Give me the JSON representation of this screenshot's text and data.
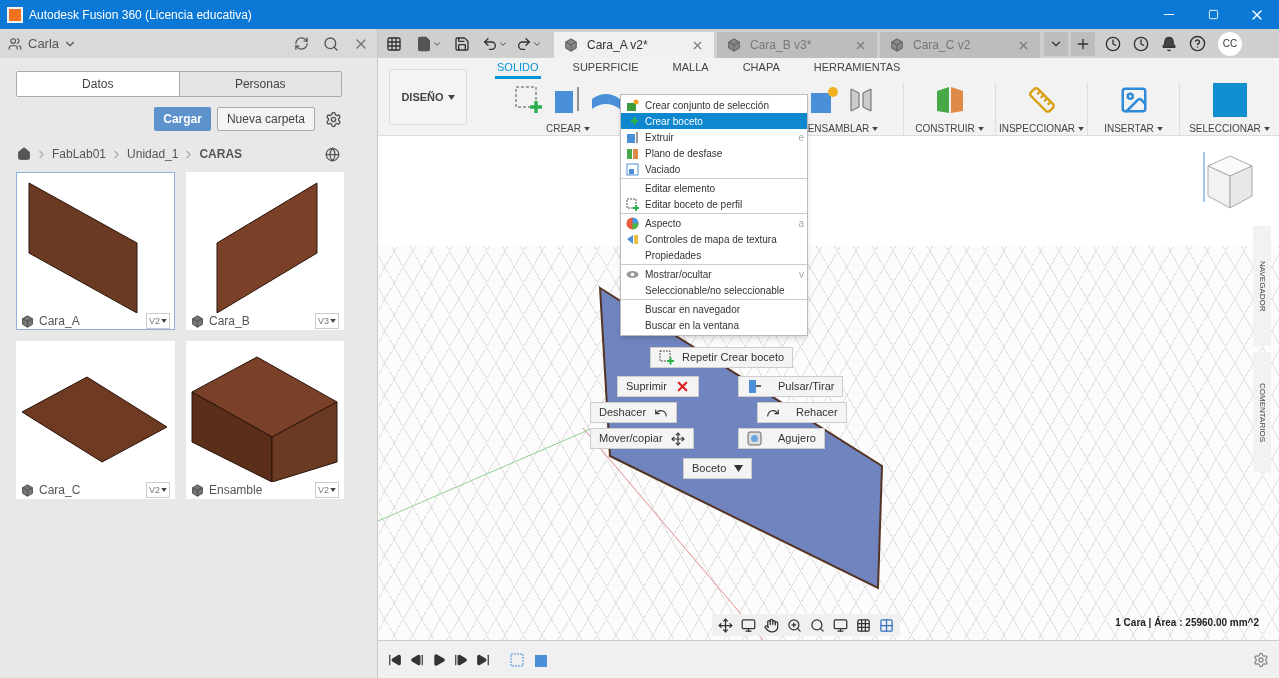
{
  "window": {
    "title": "Autodesk Fusion 360 (Licencia educativa)"
  },
  "data_panel": {
    "project": "Carla",
    "tabs": [
      {
        "label": "Datos",
        "selected": true
      },
      {
        "label": "Personas",
        "selected": false
      }
    ],
    "upload_button": "Cargar",
    "new_folder_button": "Nueva carpeta",
    "breadcrumb": [
      "FabLab01",
      "Unidad_1",
      "CARAS"
    ],
    "files": [
      {
        "name": "Cara_A",
        "version": "V2",
        "selected": true,
        "kind": "panel_a"
      },
      {
        "name": "Cara_B",
        "version": "V3",
        "selected": false,
        "kind": "panel_b"
      },
      {
        "name": "Cara_C",
        "version": "V2",
        "selected": false,
        "kind": "panel_c"
      },
      {
        "name": "Ensamble",
        "version": "V2",
        "selected": false,
        "kind": "box"
      }
    ]
  },
  "document_tabs": [
    {
      "label": "Cara_A v2*",
      "selected": true
    },
    {
      "label": "Cara_B v3*",
      "selected": false
    },
    {
      "label": "Cara_C v2",
      "selected": false
    }
  ],
  "user_initials": "CC",
  "toolbar": {
    "workspace": "DISEÑO",
    "tabs": [
      {
        "label": "SOLIDO",
        "selected": true
      },
      {
        "label": "SUPERFICIE",
        "selected": false
      },
      {
        "label": "MALLA",
        "selected": false
      },
      {
        "label": "CHAPA",
        "selected": false
      },
      {
        "label": "HERRAMIENTAS",
        "selected": false
      }
    ],
    "groups": [
      "CREAR",
      "ENSAMBLAR",
      "CONSTRUIR",
      "INSPECCIONAR",
      "INSERTAR",
      "SELECCIONAR"
    ]
  },
  "context_menu": [
    [
      {
        "label": "Crear conjunto de selección",
        "selected": false
      },
      {
        "label": "Crear boceto",
        "selected": true
      },
      {
        "label": "Extruir",
        "shortcut": "e",
        "selected": false
      },
      {
        "label": "Plano de desfase",
        "selected": false
      },
      {
        "label": "Vaciado",
        "selected": false
      }
    ],
    [
      {
        "label": "Editar elemento",
        "selected": false
      },
      {
        "label": "Editar boceto de perfil",
        "selected": false
      }
    ],
    [
      {
        "label": "Aspecto",
        "shortcut": "a",
        "selected": false
      },
      {
        "label": "Controles de mapa de textura",
        "selected": false
      },
      {
        "label": "Propiedades",
        "selected": false
      }
    ],
    [
      {
        "label": "Mostrar/ocultar",
        "shortcut": "v",
        "selected": false
      },
      {
        "label": "Seleccionable/no seleccionable",
        "selected": false
      }
    ],
    [
      {
        "label": "Buscar en navegador",
        "selected": false
      },
      {
        "label": "Buscar en la ventana",
        "selected": false
      }
    ]
  ],
  "marking_menu": [
    "Repetir Crear boceto",
    "Suprimir",
    "Pulsar/Tirar",
    "Deshacer",
    "Rehacer",
    "Mover/copiar",
    "Agujero",
    "Boceto"
  ],
  "side_panels": [
    "NAVEGADOR",
    "COMENTARIOS"
  ],
  "status": "1 Cara | Área : 25960.00 mm^2"
}
